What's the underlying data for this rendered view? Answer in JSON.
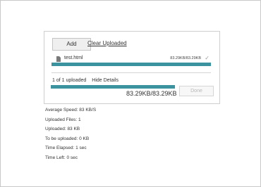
{
  "uploader": {
    "add_label": "Add",
    "clear_label": "Clear Uploaded",
    "file": {
      "name": "test.html",
      "size": "83.29KB/83.29KB",
      "progress": 1.0
    },
    "summary": "1 of 1 uploaded",
    "hide_details": "Hide Details",
    "total_progress": 1.0,
    "total_size": "83.29KB/83.29KB",
    "done_label": "Done"
  },
  "stats": [
    "Average Speed: 83 KB/S",
    "Uploaded Files: 1",
    "Uploaded: 83 KB",
    "To be uploaded: 0 KB",
    "Time Elapsed: 1 sec",
    "Time Left: 0 sec"
  ],
  "colors": {
    "accent": "#3a939e",
    "border": "#cfcfcf",
    "disabled_text": "#b7b7b7"
  },
  "icons": {
    "file": "file-icon",
    "status": "check-icon"
  }
}
